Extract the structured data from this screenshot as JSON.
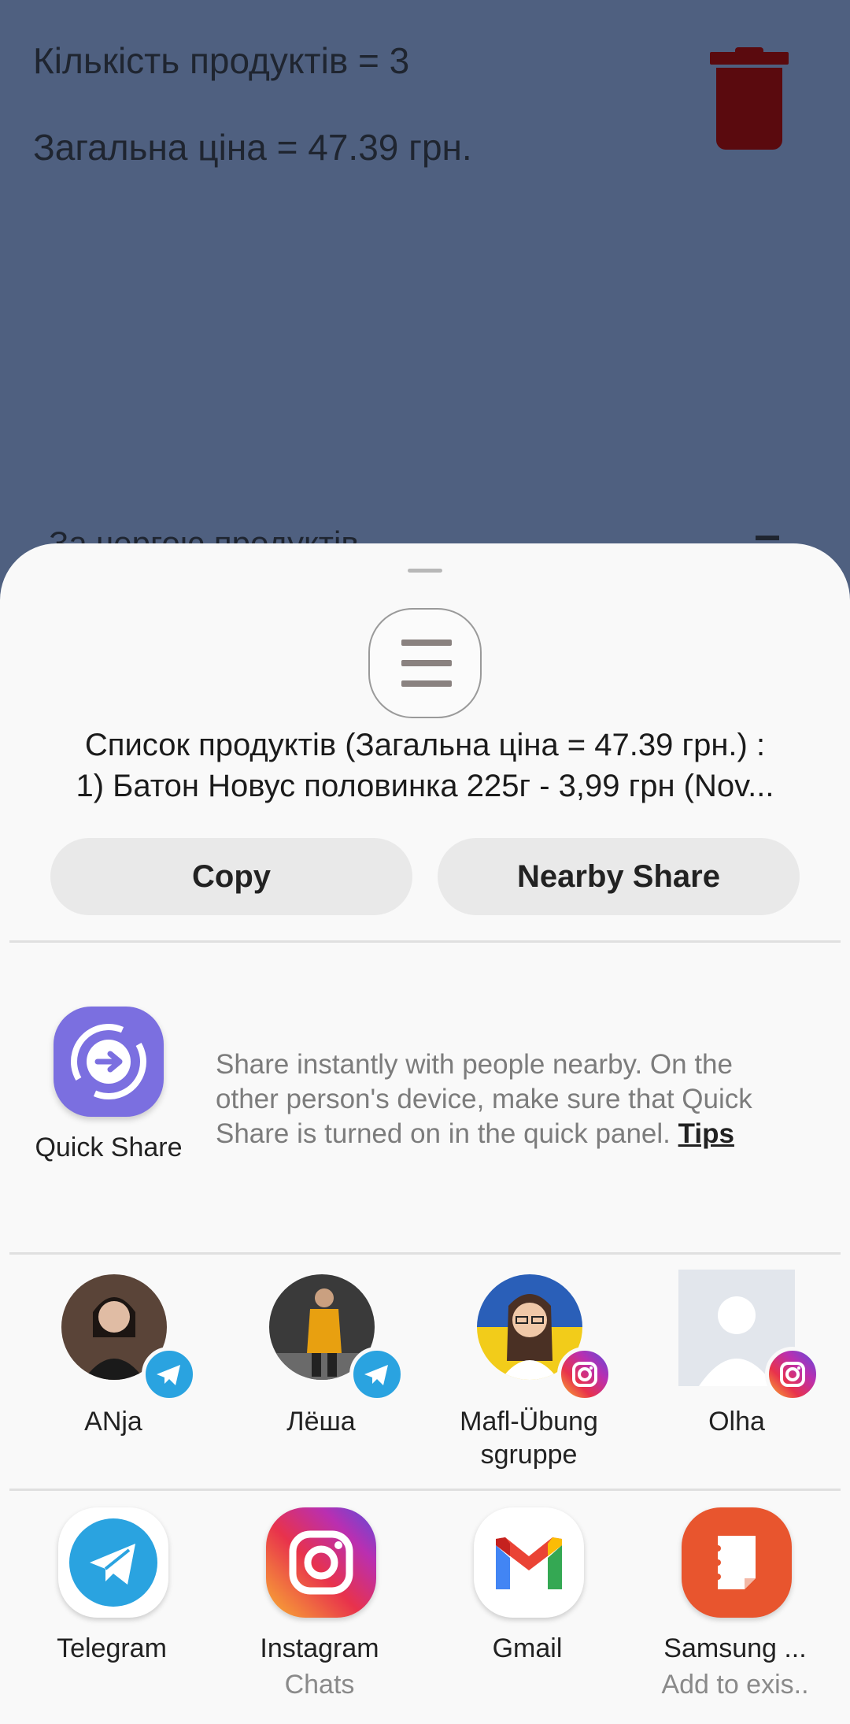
{
  "background": {
    "count_text": "Кількість продуктів = 3",
    "total_text": "Загальна ціна = 47.39 грн.",
    "sort_text": "За чергою продуктів"
  },
  "share_sheet": {
    "preview_line1": "Список продуктів (Загальна ціна = 47.39 грн.) :",
    "preview_line2": "1) Батон Новус половинка 225г - 3,99 грн (Nov...",
    "copy_label": "Copy",
    "nearby_share_label": "Nearby Share",
    "quick_share": {
      "label": "Quick Share",
      "description": "Share instantly with people nearby. On the other person's device, make sure that Quick Share is turned on in the quick panel.",
      "tips_label": "Tips"
    },
    "contacts": [
      {
        "name": "ANja",
        "app": "telegram"
      },
      {
        "name": "Лёша",
        "app": "telegram"
      },
      {
        "name": "Mafl-Übung sgruppe",
        "app": "instagram"
      },
      {
        "name": "Olha",
        "app": "instagram"
      }
    ],
    "apps": [
      {
        "name": "Telegram",
        "sub": ""
      },
      {
        "name": "Instagram",
        "sub": "Chats"
      },
      {
        "name": "Gmail",
        "sub": ""
      },
      {
        "name": "Samsung ...",
        "sub": "Add to exis.."
      }
    ]
  },
  "colors": {
    "background": "#4f6080",
    "trash": "#5a0a0e",
    "sheet": "#f9f9f9",
    "quick_share": "#7b6fe0",
    "telegram": "#2aa3e0",
    "samsung_notes": "#e8552e"
  }
}
